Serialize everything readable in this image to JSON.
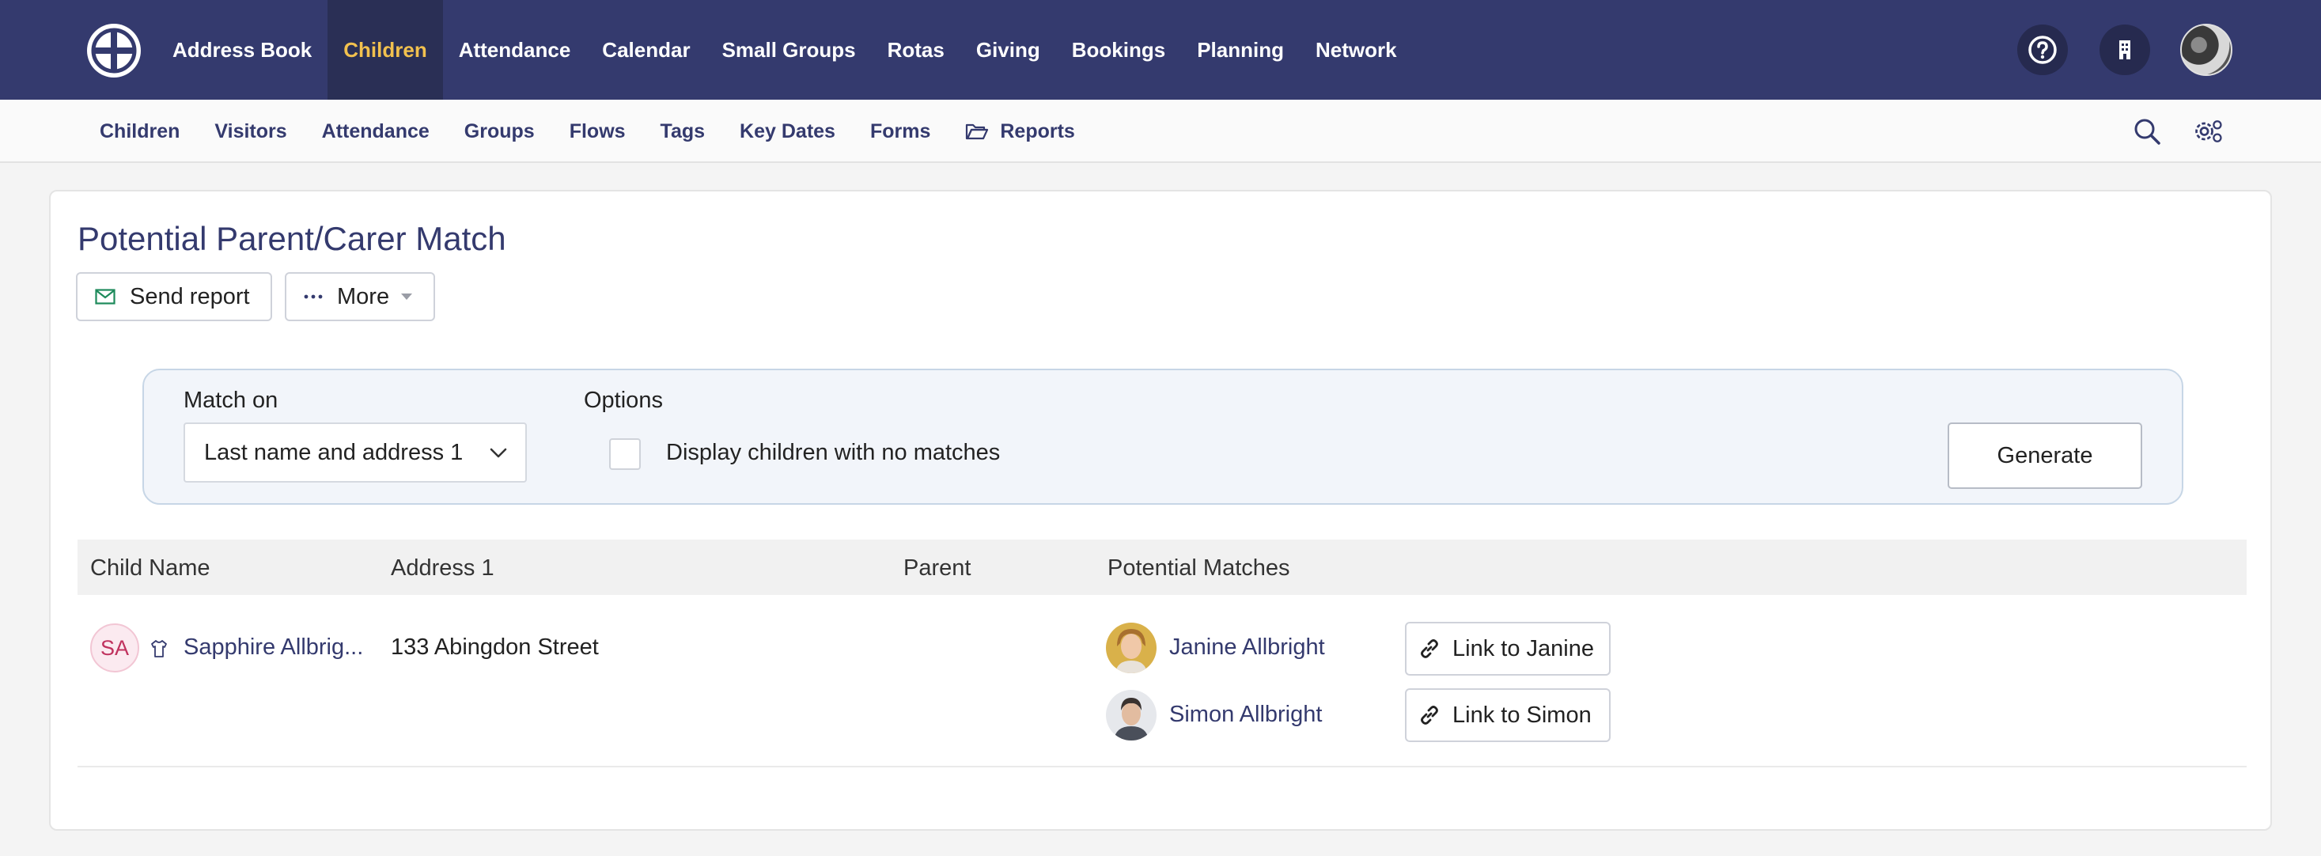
{
  "topnav": {
    "items": [
      "Address Book",
      "Children",
      "Attendance",
      "Calendar",
      "Small Groups",
      "Rotas",
      "Giving",
      "Bookings",
      "Planning",
      "Network"
    ],
    "active_index": 1,
    "active_color": "#f2c14e",
    "bg_color": "#343a6e"
  },
  "subnav": {
    "items": [
      "Children",
      "Visitors",
      "Attendance",
      "Groups",
      "Flows",
      "Tags",
      "Key Dates",
      "Forms",
      "Reports"
    ]
  },
  "page": {
    "title": "Potential Parent/Carer Match",
    "send_report_label": "Send report",
    "more_label": "More"
  },
  "filters": {
    "match_on_label": "Match on",
    "match_on_value": "Last name and address 1",
    "options_label": "Options",
    "checkbox_label": "Display children with no matches",
    "checkbox_checked": false,
    "generate_label": "Generate"
  },
  "table": {
    "headers": [
      "Child Name",
      "Address 1",
      "Parent",
      "Potential Matches"
    ],
    "rows": [
      {
        "initials": "SA",
        "child_name": "Sapphire Allbrig...",
        "address": "133 Abingdon Street",
        "parent": "",
        "matches": [
          {
            "name": "Janine Allbright",
            "button": "Link to Janine"
          },
          {
            "name": "Simon Allbright",
            "button": "Link to Simon"
          }
        ]
      }
    ]
  }
}
